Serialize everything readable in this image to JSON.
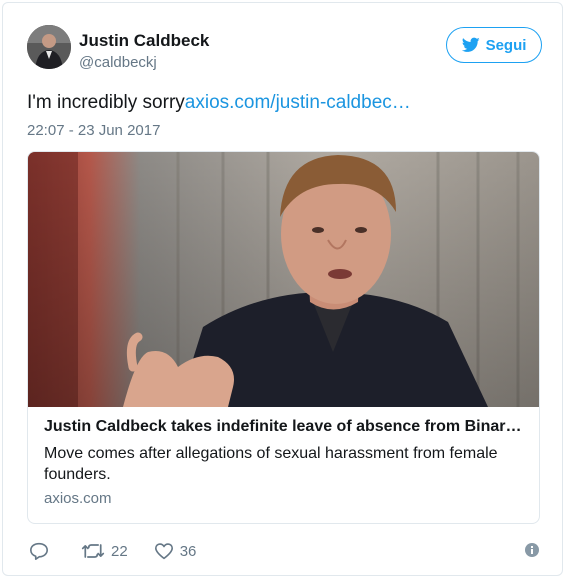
{
  "user": {
    "display_name": "Justin Caldbeck",
    "handle": "@caldbeckj"
  },
  "follow_label": "Segui",
  "tweet": {
    "text": "I'm incredibly sorry",
    "link": "axios.com/justin-caldbec…",
    "timestamp": "22:07 - 23 Jun 2017"
  },
  "card": {
    "title": "Justin Caldbeck takes indefinite leave of absence from Binary…",
    "description": "Move comes after allegations of sexual harassment from female founders.",
    "domain": "axios.com"
  },
  "actions": {
    "reply_count": "",
    "retweet_count": "22",
    "like_count": "36"
  },
  "icons": {
    "reply": "reply-icon",
    "retweet": "retweet-icon",
    "like": "heart-icon",
    "info": "info-icon",
    "follow": "twitter-bird-icon"
  },
  "colors": {
    "accent": "#1da1f2",
    "link": "#1b95e0",
    "muted": "#657786",
    "text": "#14171a",
    "border": "#e1e8ed"
  }
}
